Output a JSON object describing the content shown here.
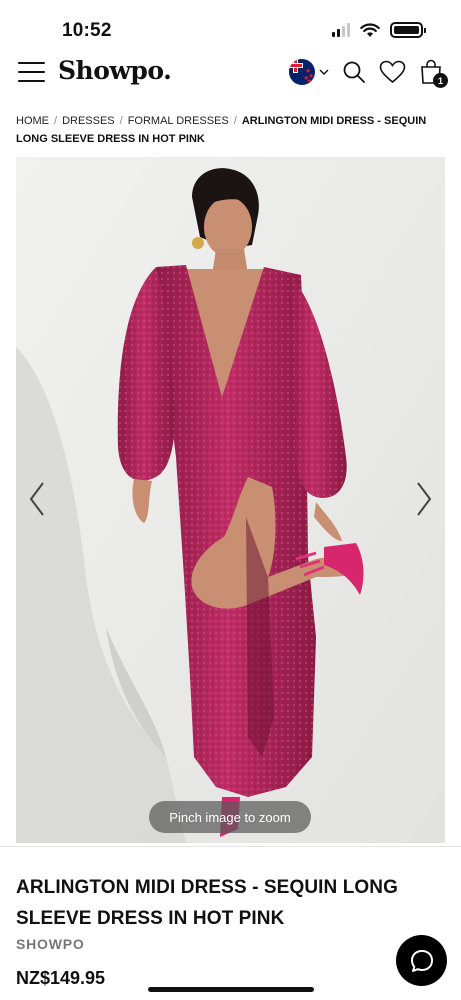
{
  "status_bar": {
    "time": "10:52"
  },
  "header": {
    "logo": "Showpo.",
    "bag_count": "1"
  },
  "breadcrumb": {
    "items": [
      "HOME",
      "DRESSES",
      "FORMAL DRESSES"
    ],
    "separator": "/",
    "current": "ARLINGTON MIDI DRESS - SEQUIN LONG SLEEVE DRESS IN HOT PINK"
  },
  "gallery": {
    "zoom_hint": "Pinch image to zoom"
  },
  "product": {
    "title": "ARLINGTON MIDI DRESS - SEQUIN LONG SLEEVE DRESS IN HOT PINK",
    "brand": "SHOWPO",
    "price": "NZ$149.95"
  },
  "colors": {
    "dress": "#b0245a",
    "background": "#ececea",
    "chat_button": "#000000"
  }
}
